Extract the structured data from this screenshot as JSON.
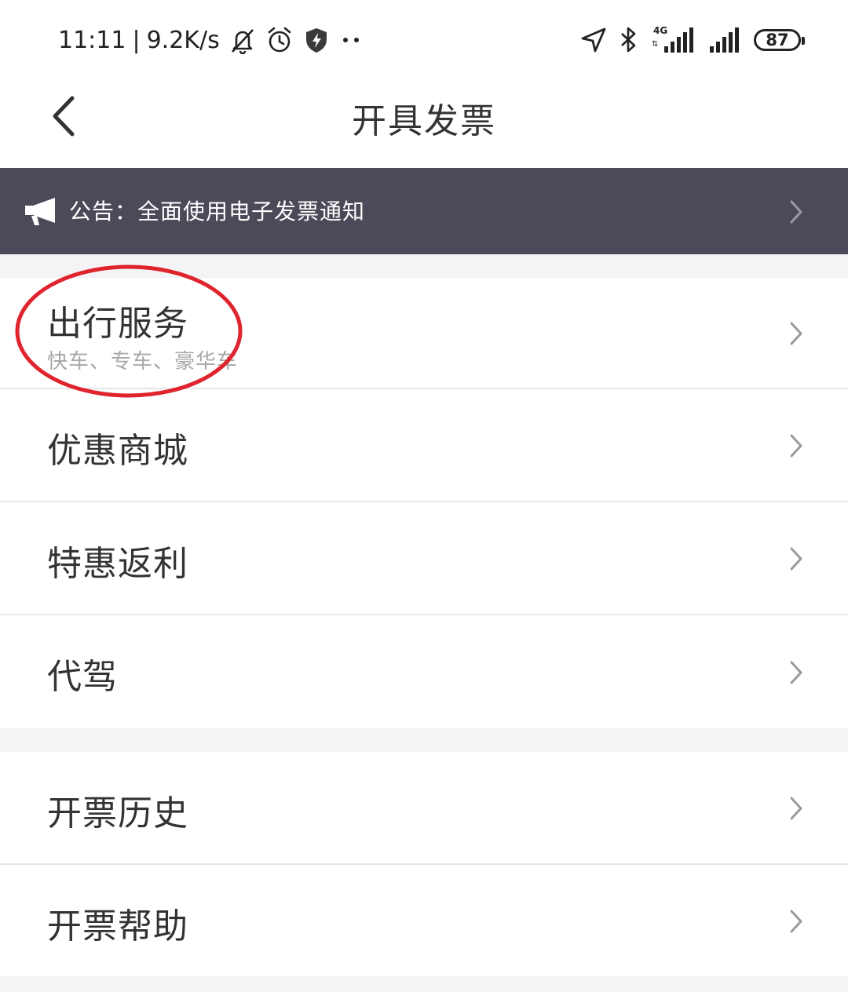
{
  "status_bar": {
    "time": "11:11",
    "separator": "|",
    "net_speed": "9.2K/s",
    "battery": "87",
    "network_label": "4G",
    "icons": [
      "bell-off-icon",
      "alarm-icon",
      "shield-icon",
      "dots-icon",
      "location-icon",
      "bluetooth-icon",
      "signal-icon",
      "battery-icon"
    ]
  },
  "nav": {
    "title": "开具发票",
    "back_icon": "chevron-left-icon"
  },
  "notice": {
    "text": "公告：全面使用电子发票通知",
    "icon": "megaphone-icon"
  },
  "menu_groups": [
    {
      "items": [
        {
          "label": "出行服务",
          "sublabel": "快车、专车、豪华车"
        },
        {
          "label": "优惠商城"
        },
        {
          "label": "特惠返利"
        },
        {
          "label": "代驾"
        }
      ]
    },
    {
      "items": [
        {
          "label": "开票历史"
        },
        {
          "label": "开票帮助"
        }
      ]
    }
  ],
  "colors": {
    "banner_bg": "#4b4a58",
    "highlight_circle": "#e0242e",
    "section_gap": "#f4f4f6"
  }
}
